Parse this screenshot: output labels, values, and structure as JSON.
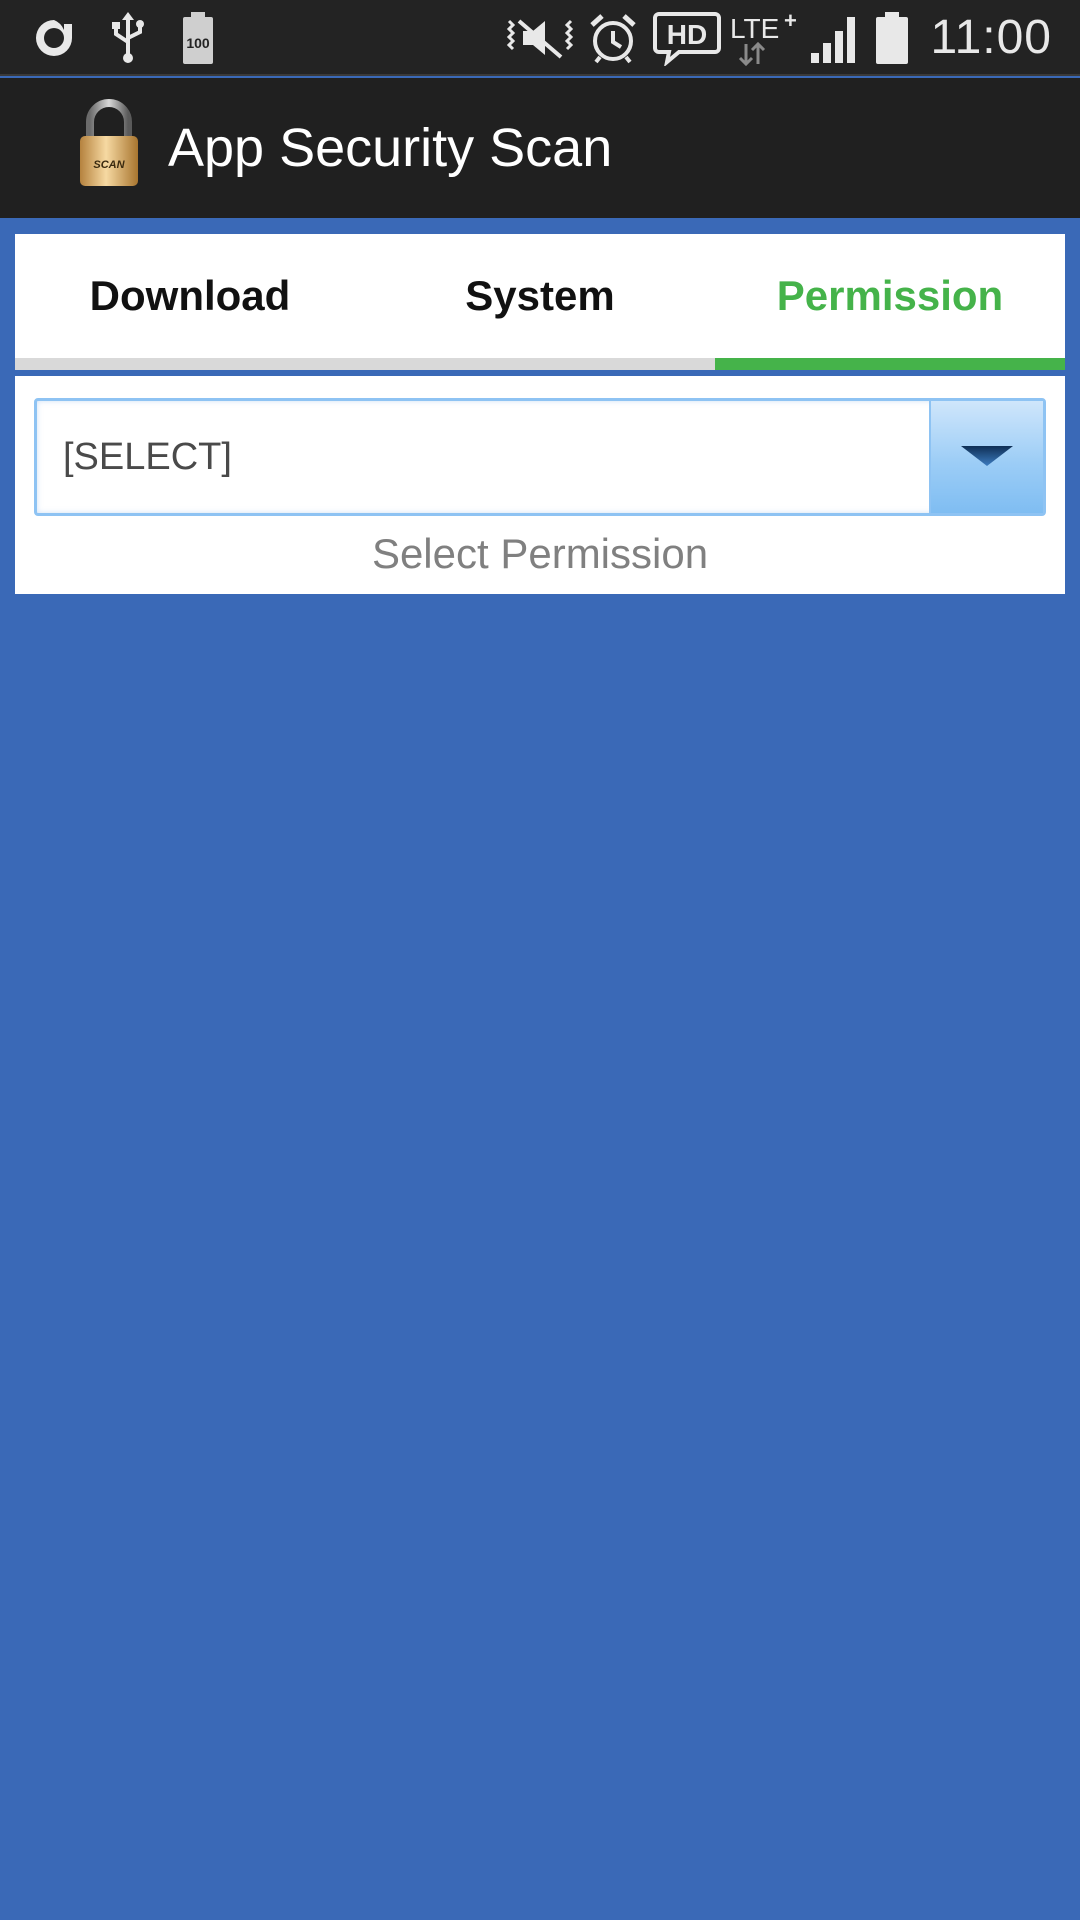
{
  "status_bar": {
    "time": "11:00",
    "battery_level_label": "100",
    "icons": [
      "app-notification-icon",
      "usb-icon",
      "battery-100-icon",
      "vibrate-mute-icon",
      "alarm-icon",
      "hd-voice-icon",
      "lte-plus-icon",
      "signal-icon",
      "battery-icon"
    ]
  },
  "app_bar": {
    "title": "App Security Scan",
    "logo_label": "SCAN"
  },
  "tabs": [
    {
      "label": "Download",
      "active": false
    },
    {
      "label": "System",
      "active": false
    },
    {
      "label": "Permission",
      "active": true
    }
  ],
  "permission_select": {
    "value": "[SELECT]",
    "hint": "Select Permission"
  },
  "colors": {
    "background": "#3a69b7",
    "accent_active_tab": "#45b34a",
    "action_bar": "#202020",
    "status_bar": "#232323"
  }
}
